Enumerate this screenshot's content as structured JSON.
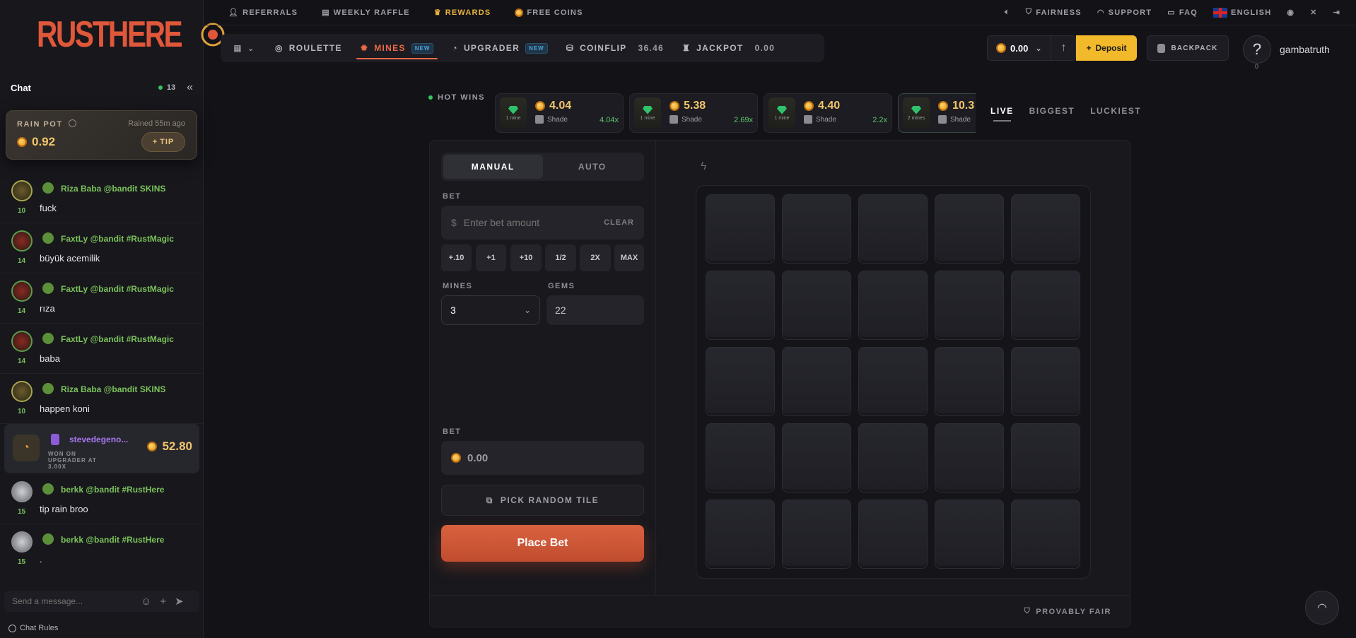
{
  "brand": {
    "logo_text": "RUSTHERE"
  },
  "topbar": {
    "left": [
      {
        "label": "REFERRALS",
        "icon": "person-icon"
      },
      {
        "label": "WEEKLY RAFFLE",
        "icon": "ticket-icon"
      },
      {
        "label": "REWARDS",
        "icon": "crown-icon"
      },
      {
        "label": "FREE COINS",
        "icon": "coin-icon"
      }
    ],
    "right": [
      {
        "label": "FAIRNESS",
        "icon": "shield-icon"
      },
      {
        "label": "SUPPORT",
        "icon": "headset-icon"
      },
      {
        "label": "FAQ",
        "icon": "chat-bubble-icon"
      },
      {
        "label": "ENGLISH",
        "icon": "uk-flag-icon"
      }
    ]
  },
  "nav": {
    "items": [
      {
        "label": "ROULETTE"
      },
      {
        "label": "MINES",
        "badge": "NEW",
        "active": true
      },
      {
        "label": "UPGRADER",
        "badge": "NEW"
      },
      {
        "label": "COINFLIP",
        "value": "36.46"
      },
      {
        "label": "JACKPOT",
        "value": "0.00"
      }
    ]
  },
  "account": {
    "balance": "0.00",
    "deposit_label": "Deposit",
    "backpack_label": "BACKPACK",
    "username": "gambatruth",
    "level": "0",
    "avatar_glyph": "?"
  },
  "chat": {
    "title": "Chat",
    "online_count": "13",
    "rain": {
      "label": "RAIN POT",
      "ago": "Rained 55m ago",
      "amount": "0.92",
      "tip_label": "TIP"
    },
    "messages": [
      {
        "name": "Riza Baba @bandit SKINS",
        "level": "10",
        "text": "fuck",
        "avatar": "gold"
      },
      {
        "name": "FaxtLy @bandit #RustMagic",
        "level": "14",
        "text": "büyük acemilik",
        "avatar": "red"
      },
      {
        "name": "FaxtLy @bandit #RustMagic",
        "level": "14",
        "text": "rıza",
        "avatar": "red"
      },
      {
        "name": "FaxtLy @bandit #RustMagic",
        "level": "14",
        "text": "baba",
        "avatar": "red"
      },
      {
        "name": "Riza Baba @bandit SKINS",
        "level": "10",
        "text": "happen koni",
        "avatar": "gold"
      }
    ],
    "win": {
      "name": "stevedegeno...",
      "desc": "WON ON UPGRADER AT 3.00X",
      "amount": "52.80"
    },
    "messages2": [
      {
        "name": "berkk @bandit #RustHere",
        "level": "15",
        "text": "tip rain broo",
        "avatar": "gray"
      },
      {
        "name": "berkk @bandit #RustHere",
        "level": "15",
        "text": ".",
        "avatar": "gray"
      }
    ],
    "input_placeholder": "Send a message...",
    "rules_label": "Chat Rules"
  },
  "hot_wins": {
    "label": "HOT WINS",
    "items": [
      {
        "amount": "4.04",
        "user": "Shade",
        "mult": "4.04x",
        "mines": "1 mine"
      },
      {
        "amount": "5.38",
        "user": "Shade",
        "mult": "2.69x",
        "mines": "1 mine"
      },
      {
        "amount": "4.40",
        "user": "Shade",
        "mult": "2.2x",
        "mines": "1 mine"
      },
      {
        "amount": "10.3",
        "user": "Shade",
        "mult": "",
        "mines": "2 mines"
      }
    ],
    "tabs": [
      "LIVE",
      "BIGGEST",
      "LUCKIEST"
    ]
  },
  "game": {
    "modes": [
      "MANUAL",
      "AUTO"
    ],
    "bet_label": "BET",
    "bet_placeholder": "Enter bet amount",
    "currency_symbol": "$",
    "clear_label": "CLEAR",
    "quick": [
      "+.10",
      "+1",
      "+10",
      "1/2",
      "2X",
      "MAX"
    ],
    "mines_label": "MINES",
    "mines_value": "3",
    "gems_label": "GEMS",
    "gems_value": "22",
    "bet2_label": "BET",
    "bet2_value": "0.00",
    "random_label": "PICK RANDOM TILE",
    "place_label": "Place Bet",
    "provably_fair": "PROVABLY FAIR"
  }
}
